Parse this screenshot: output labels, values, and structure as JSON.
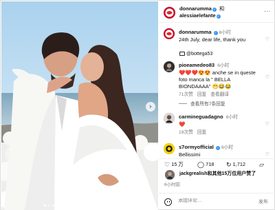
{
  "header": {
    "user1": "donnarumma",
    "and": "和",
    "user2": "alessiaelefante",
    "more": "..."
  },
  "caption": {
    "user": "donnarumma",
    "time": "6小时",
    "text": "24th July, dear life, thank you",
    "mention": "@bottega53"
  },
  "comments": [
    {
      "user": "pioeamedeo83",
      "time": "6小时",
      "text": "❤️❤️❤️😍😍 anche se in queste foto manca la \" BELLA BIONDAAAA\" 😁😂😂",
      "likes": "71次赞",
      "reply": "回复",
      "translate": "查看翻译",
      "view_replies": "查看所有7条回复"
    },
    {
      "user": "carmineguadagno",
      "time": "6小时",
      "text": "❤️",
      "likes": "19次赞",
      "reply": "回复"
    },
    {
      "user": "s7ormyofficial",
      "time": "6小时",
      "text": "Bellissimi"
    }
  ],
  "actions": {
    "likes": "15 万",
    "comments": "718",
    "shares": "1,712",
    "liked_by": "jackgrealish和其他15万位用户赞了",
    "post_time": "6小时前"
  },
  "comment_box": {
    "placeholder": "添加评论…",
    "send": "发布"
  },
  "icons": {
    "heart": "heart-icon",
    "comment": "comment-icon",
    "share": "share-icon",
    "save": "bookmark-icon",
    "emoji": "emoji-icon",
    "verified": "verified-icon"
  },
  "colors": {
    "accent": "#3897f0",
    "like": "#ed4956"
  }
}
